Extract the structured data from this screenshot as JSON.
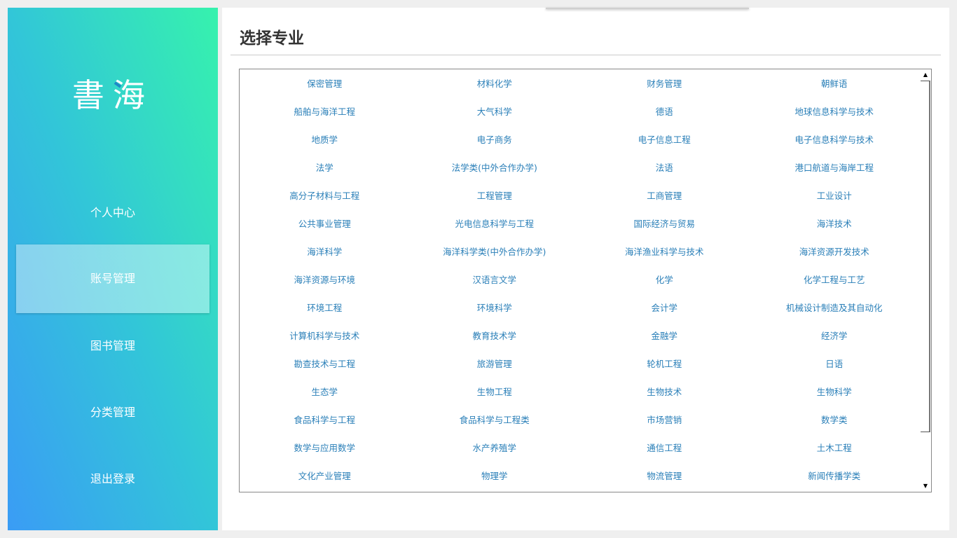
{
  "sidebar": {
    "logo_text": "書海",
    "nav": [
      {
        "label": "个人中心"
      },
      {
        "label": "账号管理"
      },
      {
        "label": "图书管理"
      },
      {
        "label": "分类管理"
      },
      {
        "label": "退出登录"
      }
    ],
    "active_index": 1
  },
  "main": {
    "title": "选择专业",
    "majors": [
      "保密管理",
      "材料化学",
      "财务管理",
      "朝鲜语",
      "船舶与海洋工程",
      "大气科学",
      "德语",
      "地球信息科学与技术",
      "地质学",
      "电子商务",
      "电子信息工程",
      "电子信息科学与技术",
      "法学",
      "法学类(中外合作办学)",
      "法语",
      "港口航道与海岸工程",
      "高分子材料与工程",
      "工程管理",
      "工商管理",
      "工业设计",
      "公共事业管理",
      "光电信息科学与工程",
      "国际经济与贸易",
      "海洋技术",
      "海洋科学",
      "海洋科学类(中外合作办学)",
      "海洋渔业科学与技术",
      "海洋资源开发技术",
      "海洋资源与环境",
      "汉语言文学",
      "化学",
      "化学工程与工艺",
      "环境工程",
      "环境科学",
      "会计学",
      "机械设计制造及其自动化",
      "计算机科学与技术",
      "教育技术学",
      "金融学",
      "经济学",
      "勘查技术与工程",
      "旅游管理",
      "轮机工程",
      "日语",
      "生态学",
      "生物工程",
      "生物技术",
      "生物科学",
      "食品科学与工程",
      "食品科学与工程类",
      "市场营销",
      "数学类",
      "数学与应用数学",
      "水产养殖学",
      "通信工程",
      "土木工程",
      "文化产业管理",
      "物理学",
      "物流管理",
      "新闻传播学类"
    ]
  },
  "scrollbar": {
    "up_glyph": "▲",
    "down_glyph": "▼"
  },
  "colors": {
    "sidebar_gradient_start": "#3a9cf5",
    "sidebar_gradient_end": "#36f2ad",
    "link": "#2a7fb8"
  }
}
